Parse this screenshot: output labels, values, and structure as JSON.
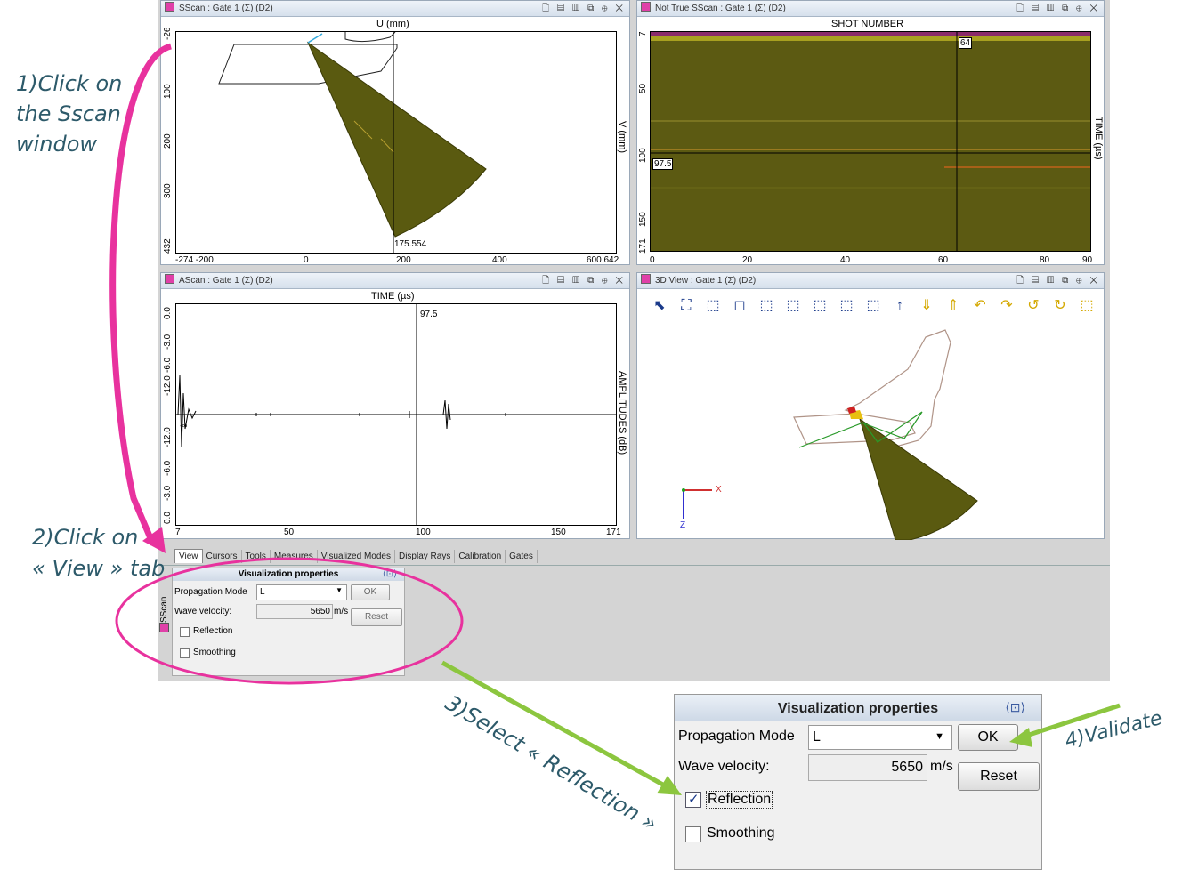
{
  "annotations": {
    "step1": [
      "1)Click on",
      "the Sscan",
      "window"
    ],
    "step2": [
      "2)Click on",
      "« View » tab"
    ],
    "step3": "3)Select « Reflection »",
    "step4": "4)Validate"
  },
  "colors": {
    "annotation_text": "#2d5a6a",
    "magenta": "#e8329e",
    "green_arrow": "#8cc63f",
    "scan_fill": "#5a5a10"
  },
  "panels": {
    "sscan": {
      "title": "SScan  : Gate 1 (Σ) (D2)",
      "x_axis_label": "U (mm)",
      "y_axis_label": "V (mm)",
      "x_ticks": [
        "-274 -200",
        "0",
        "200",
        "400",
        "600 642"
      ],
      "y_ticks": [
        "-26",
        "100",
        "200",
        "300",
        "432"
      ],
      "cursor_value": "175.554"
    },
    "not_true_sscan": {
      "title": "Not True SScan  : Gate 1 (Σ) (D2)",
      "x_axis_label": "SHOT NUMBER",
      "y_axis_label": "TIME (µs)",
      "x_ticks": [
        "0",
        "20",
        "40",
        "60",
        "80",
        "90"
      ],
      "y_ticks": [
        "7",
        "50",
        "100",
        "150",
        "171"
      ],
      "cursor_x": "64",
      "cursor_y": "97.5"
    },
    "ascan": {
      "title": "AScan  : Gate 1 (Σ) (D2)",
      "x_axis_label": "TIME (µs)",
      "y_axis_label": "AMPLITUDES (dB)",
      "x_ticks": [
        "7",
        "50",
        "100",
        "150",
        "171"
      ],
      "y_ticks": [
        "0.0",
        "-3.0",
        "-6.0",
        "-12.0",
        "-∞",
        "-12.0",
        "-6.0",
        "-3.0",
        "0.0"
      ],
      "cursor_value": "97.5",
      "infinity_label": "-∞"
    },
    "view3d": {
      "title": "3D View  : Gate 1 (Σ) (D2)",
      "axis_x": "X",
      "axis_z": "Z"
    }
  },
  "tabs": [
    "View",
    "Cursors",
    "Tools",
    "Measures",
    "Visualized Modes",
    "Display Rays",
    "Calibration",
    "Gates"
  ],
  "side_label": "SScan",
  "vis_props_small": {
    "header": "Visualization properties",
    "propagation_label": "Propagation Mode",
    "propagation_value": "L",
    "ok": "OK",
    "velocity_label": "Wave velocity:",
    "velocity_value": "5650",
    "velocity_unit": "m/s",
    "reset": "Reset",
    "reflection": "Reflection",
    "reflection_checked": false,
    "smoothing": "Smoothing",
    "smoothing_checked": false
  },
  "vis_props_big": {
    "header": "Visualization properties",
    "propagation_label": "Propagation Mode",
    "propagation_value": "L",
    "ok": "OK",
    "velocity_label": "Wave velocity:",
    "velocity_value": "5650",
    "velocity_unit": "m/s",
    "reset": "Reset",
    "reflection": "Reflection",
    "reflection_checked": true,
    "smoothing": "Smoothing",
    "smoothing_checked": false
  }
}
